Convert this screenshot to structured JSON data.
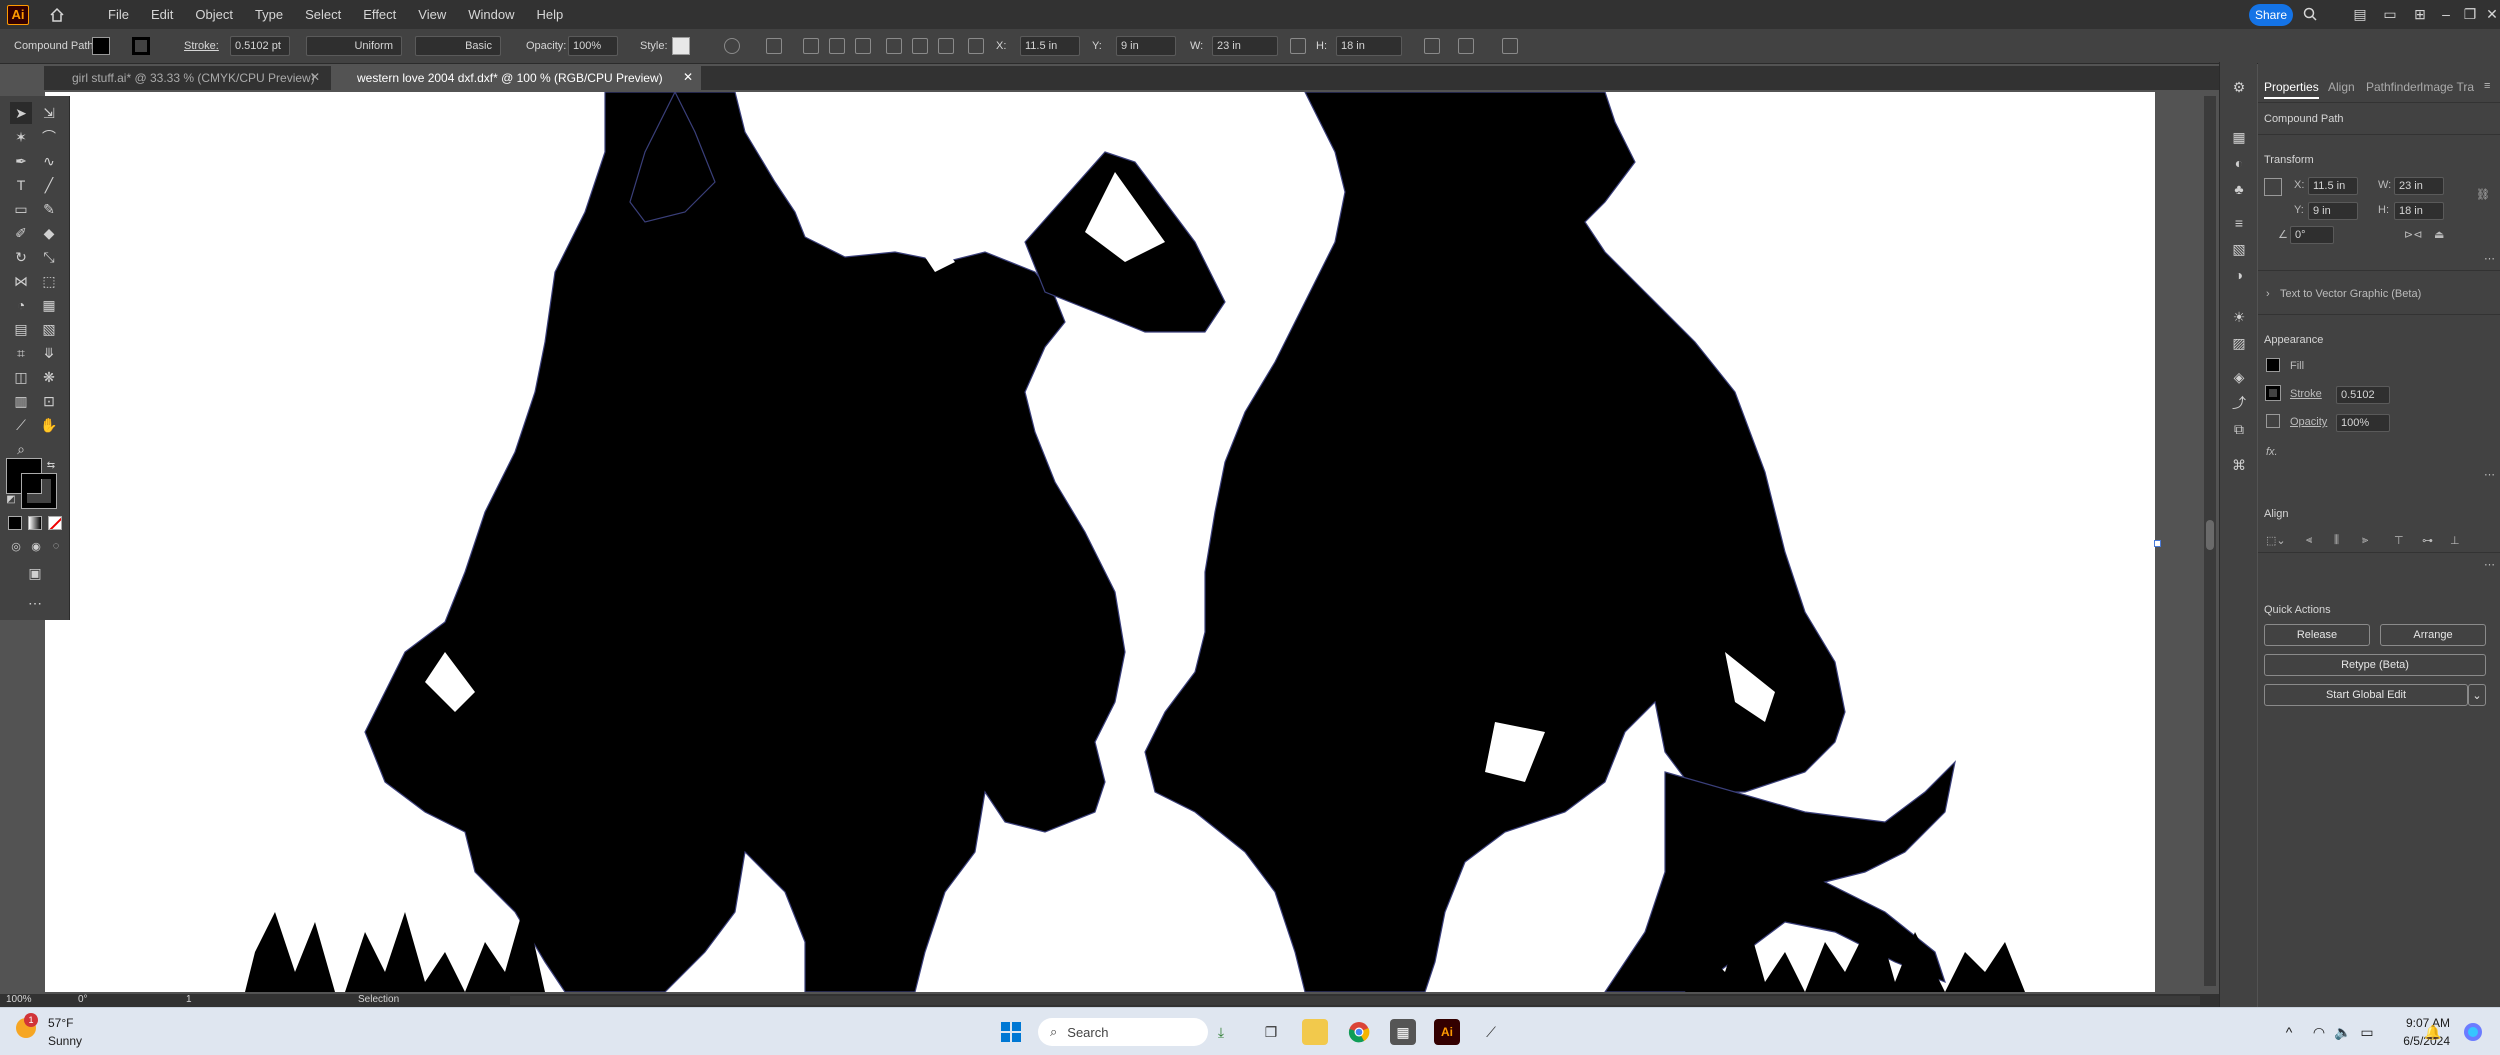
{
  "app": {
    "logo_text": "Ai",
    "menu": [
      "File",
      "Edit",
      "Object",
      "Type",
      "Select",
      "Effect",
      "View",
      "Window",
      "Help"
    ],
    "share_label": "Share"
  },
  "control_bar": {
    "selection_type": "Compound Path",
    "stroke_label": "Stroke:",
    "stroke_value": "0.5102 pt",
    "stroke_profile": "Uniform",
    "brush": "Basic",
    "opacity_label": "Opacity:",
    "opacity_value": "100%",
    "style_label": "Style:",
    "x_label": "X:",
    "x_value": "11.5 in",
    "y_label": "Y:",
    "y_value": "9 in",
    "w_label": "W:",
    "w_value": "23 in",
    "h_label": "H:",
    "h_value": "18 in"
  },
  "tabs": [
    {
      "label": "girl stuff.ai* @ 33.33 % (CMYK/CPU Preview)",
      "active": false
    },
    {
      "label": "western love 2004 dxf.dxf* @ 100 % (RGB/CPU Preview)",
      "active": true
    }
  ],
  "properties": {
    "tabs": [
      "Properties",
      "Align",
      "Pathfinder",
      "Image Tra"
    ],
    "selection_type": "Compound Path",
    "transform_title": "Transform",
    "x_label": "X:",
    "x_value": "11.5 in",
    "y_label": "Y:",
    "y_value": "9 in",
    "w_label": "W:",
    "w_value": "23 in",
    "h_label": "H:",
    "h_value": "18 in",
    "angle_value": "0°",
    "text_to_vector": "Text to Vector Graphic (Beta)",
    "appearance_title": "Appearance",
    "fill_label": "Fill",
    "stroke_label": "Stroke",
    "stroke_value": "0.5102",
    "opacity_label": "Opacity",
    "opacity_value": "100%",
    "fx_label": "fx.",
    "align_title": "Align",
    "quick_actions_title": "Quick Actions",
    "release_label": "Release",
    "arrange_label": "Arrange",
    "retype_label": "Retype (Beta)",
    "global_edit_label": "Start Global Edit"
  },
  "status_bar": {
    "zoom": "100%",
    "rotation": "0°",
    "artboard_number": "1",
    "tool_name": "Selection"
  },
  "taskbar": {
    "weather_temp": "57°F",
    "weather_desc": "Sunny",
    "weather_badge": "1",
    "search_placeholder": "Search",
    "time": "9:07 AM",
    "date": "6/5/2024"
  }
}
